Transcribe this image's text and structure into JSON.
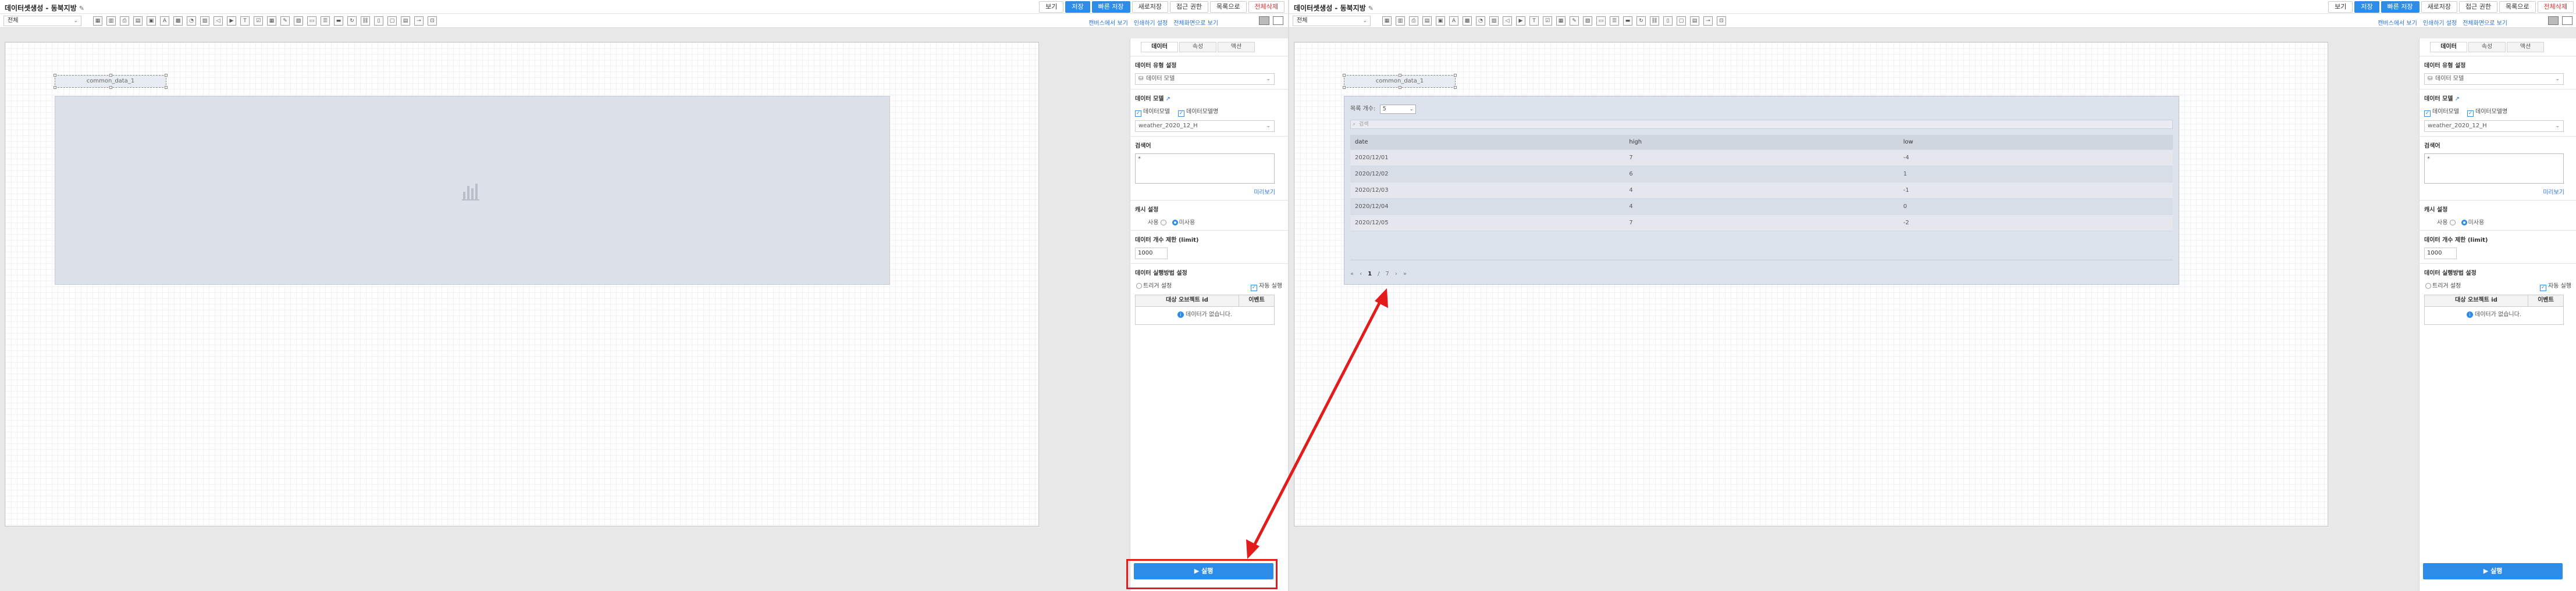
{
  "header": {
    "title": "데이터셋생성 - 동북지방",
    "buttons": [
      "보기",
      "저장",
      "빠른 저장",
      "새로저장",
      "접근 권한",
      "목록으로",
      "전체삭제"
    ]
  },
  "toolbar": {
    "select_value": "전체",
    "links": [
      "캔버스에서 보기",
      "인쇄하기 설정",
      "전체화면으로 보기"
    ]
  },
  "canvas": {
    "label_text": "common_data_1"
  },
  "table_widget": {
    "count_label": "목록 개수:",
    "count_value": "5",
    "search_placeholder": "검색",
    "columns": [
      "date",
      "high",
      "low"
    ],
    "rows": [
      [
        "2020/12/01",
        "7",
        "-4"
      ],
      [
        "2020/12/02",
        "6",
        "1"
      ],
      [
        "2020/12/03",
        "4",
        "-1"
      ],
      [
        "2020/12/04",
        "4",
        "0"
      ],
      [
        "2020/12/05",
        "7",
        "-2"
      ]
    ],
    "pager": {
      "first": "«",
      "prev": "‹",
      "current": "1",
      "sep": "/",
      "total": "7",
      "next": "›",
      "last": "»"
    }
  },
  "side_panel": {
    "tabs": [
      "데이터",
      "속성",
      "액션"
    ],
    "source_title": "데이터 유형 설정",
    "source_value": "데이터 모델",
    "model_title": "데이터 모델",
    "check1": "데이터모델",
    "check2": "데이터모델명",
    "model_value": "weather_2020_12_H",
    "condition_title": "검색어",
    "condition_value": "*",
    "preview_link": "미리보기",
    "cache_title": "캐시 설정",
    "cache_use": "사용",
    "cache_nouse": "미사용",
    "limit_title": "데이터 개수 제한 (limit)",
    "limit_value": "1000",
    "exec_title": "데이터 실행방법 설정",
    "trigger_label": "트리거 설정",
    "auto_label": "자동 실행",
    "table_col1": "대상 오브젝트 id",
    "table_col2": "이벤트",
    "empty_text": "데이터가 없습니다.",
    "run_button": "▶ 실행"
  },
  "colors": {
    "accent": "#2d8ce8",
    "annotation": "#e31b1b"
  }
}
